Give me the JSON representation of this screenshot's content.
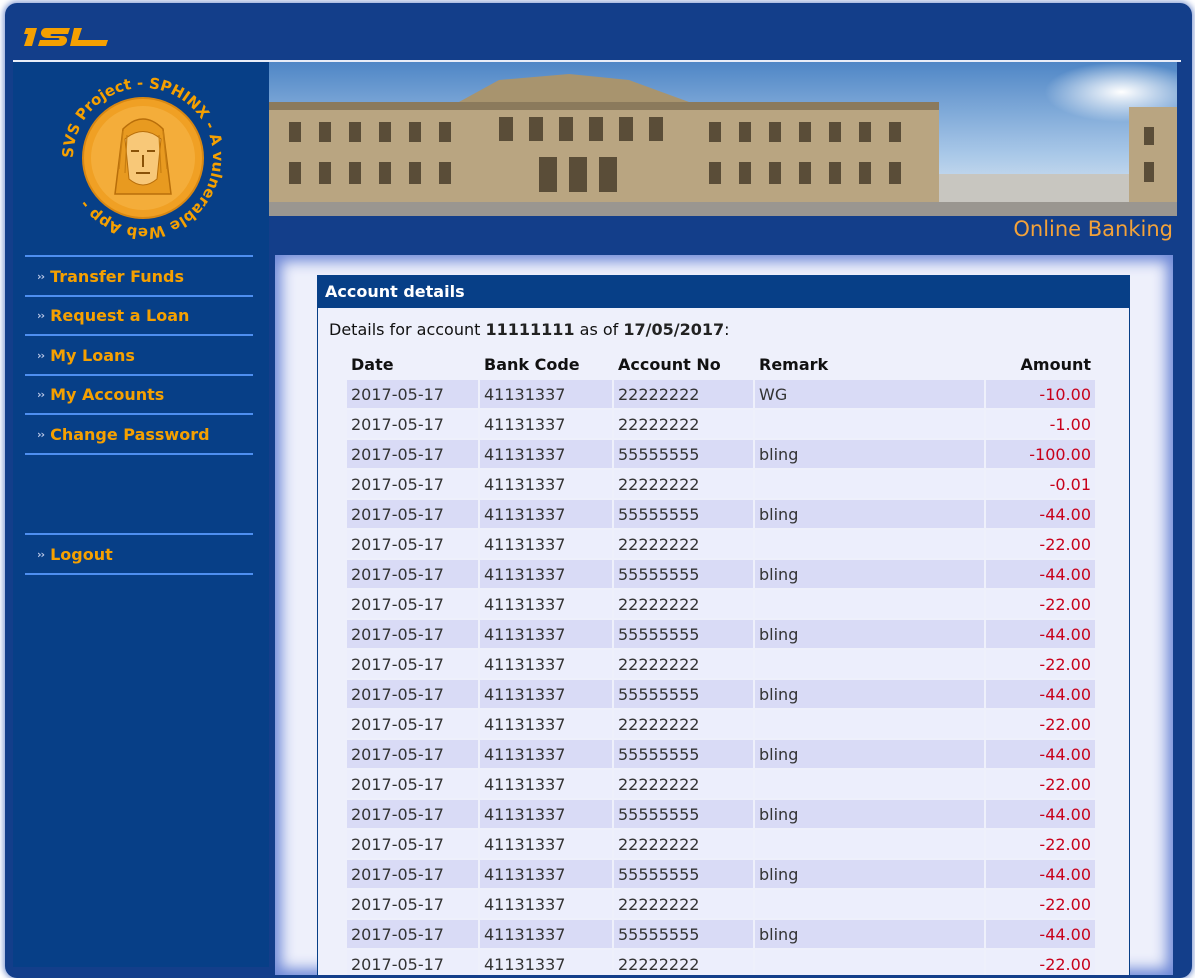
{
  "header": {
    "logo_text": "ISL"
  },
  "sidebar": {
    "seal_text": "SVS Project - SPHINX - A vulnerable Web App -",
    "nav": [
      {
        "label": "Transfer Funds"
      },
      {
        "label": "Request a Loan"
      },
      {
        "label": "My Loans"
      },
      {
        "label": "My Accounts"
      },
      {
        "label": "Change Password"
      }
    ],
    "logout": {
      "label": "Logout"
    }
  },
  "banner": {
    "caption": "Online Banking"
  },
  "panel": {
    "title": "Account details",
    "details_prefix": "Details for account",
    "account": "11111111",
    "details_mid": "as of",
    "date": "17/05/2017",
    "details_suffix": ":"
  },
  "table": {
    "headers": {
      "date": "Date",
      "bank_code": "Bank Code",
      "account_no": "Account No",
      "remark": "Remark",
      "amount": "Amount"
    },
    "rows": [
      {
        "date": "2017-05-17",
        "bank": "41131337",
        "acct": "22222222",
        "remark": "WG",
        "amount": "-10.00"
      },
      {
        "date": "2017-05-17",
        "bank": "41131337",
        "acct": "22222222",
        "remark": "",
        "amount": "-1.00"
      },
      {
        "date": "2017-05-17",
        "bank": "41131337",
        "acct": "55555555",
        "remark": "bling",
        "amount": "-100.00"
      },
      {
        "date": "2017-05-17",
        "bank": "41131337",
        "acct": "22222222",
        "remark": "",
        "amount": "-0.01"
      },
      {
        "date": "2017-05-17",
        "bank": "41131337",
        "acct": "55555555",
        "remark": "bling",
        "amount": "-44.00"
      },
      {
        "date": "2017-05-17",
        "bank": "41131337",
        "acct": "22222222",
        "remark": "",
        "amount": "-22.00"
      },
      {
        "date": "2017-05-17",
        "bank": "41131337",
        "acct": "55555555",
        "remark": "bling",
        "amount": "-44.00"
      },
      {
        "date": "2017-05-17",
        "bank": "41131337",
        "acct": "22222222",
        "remark": "",
        "amount": "-22.00"
      },
      {
        "date": "2017-05-17",
        "bank": "41131337",
        "acct": "55555555",
        "remark": "bling",
        "amount": "-44.00"
      },
      {
        "date": "2017-05-17",
        "bank": "41131337",
        "acct": "22222222",
        "remark": "",
        "amount": "-22.00"
      },
      {
        "date": "2017-05-17",
        "bank": "41131337",
        "acct": "55555555",
        "remark": "bling",
        "amount": "-44.00"
      },
      {
        "date": "2017-05-17",
        "bank": "41131337",
        "acct": "22222222",
        "remark": "",
        "amount": "-22.00"
      },
      {
        "date": "2017-05-17",
        "bank": "41131337",
        "acct": "55555555",
        "remark": "bling",
        "amount": "-44.00"
      },
      {
        "date": "2017-05-17",
        "bank": "41131337",
        "acct": "22222222",
        "remark": "",
        "amount": "-22.00"
      },
      {
        "date": "2017-05-17",
        "bank": "41131337",
        "acct": "55555555",
        "remark": "bling",
        "amount": "-44.00"
      },
      {
        "date": "2017-05-17",
        "bank": "41131337",
        "acct": "22222222",
        "remark": "",
        "amount": "-22.00"
      },
      {
        "date": "2017-05-17",
        "bank": "41131337",
        "acct": "55555555",
        "remark": "bling",
        "amount": "-44.00"
      },
      {
        "date": "2017-05-17",
        "bank": "41131337",
        "acct": "22222222",
        "remark": "",
        "amount": "-22.00"
      },
      {
        "date": "2017-05-17",
        "bank": "41131337",
        "acct": "55555555",
        "remark": "bling",
        "amount": "-44.00"
      },
      {
        "date": "2017-05-17",
        "bank": "41131337",
        "acct": "22222222",
        "remark": "",
        "amount": "-22.00"
      }
    ]
  },
  "colors": {
    "brand_blue": "#073f87",
    "accent_orange": "#f5a000",
    "negative": "#c8001a"
  }
}
